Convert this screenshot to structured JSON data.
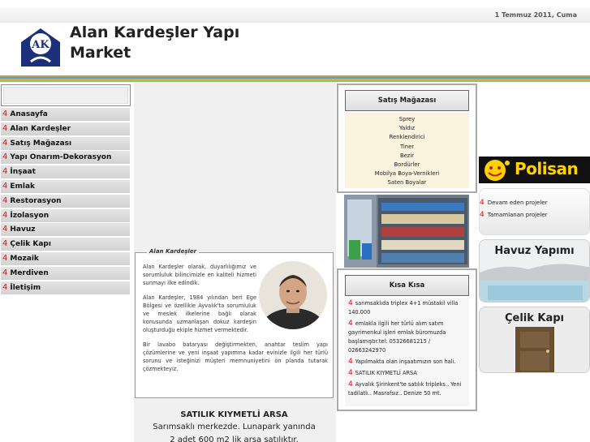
{
  "header": {
    "date": "1 Temmuz 2011, Cuma",
    "site_title": "Alan Kardeşler Yapı Market",
    "logo_text": "AK"
  },
  "colors": {
    "accent_red": "#dd1111",
    "stripe_colors": [
      "#b8a15a",
      "#5aa0c8",
      "#e0b030",
      "#8fbf8f"
    ],
    "store_panel_bg": "#fbf3dd",
    "polisan_yellow": "#ffd200"
  },
  "sidebar": {
    "search_placeholder": "",
    "items": [
      {
        "num": "4",
        "label": "Anasayfa"
      },
      {
        "num": "4",
        "label": "Alan Kardeşler"
      },
      {
        "num": "4",
        "label": "Satış Mağazası"
      },
      {
        "num": "4",
        "label": "Yapı Onarım-Dekorasyon"
      },
      {
        "num": "4",
        "label": "İnşaat"
      },
      {
        "num": "4",
        "label": "Emlak"
      },
      {
        "num": "4",
        "label": "Restorasyon"
      },
      {
        "num": "4",
        "label": "İzolasyon"
      },
      {
        "num": "4",
        "label": "Havuz"
      },
      {
        "num": "4",
        "label": "Çelik Kapı"
      },
      {
        "num": "4",
        "label": "Mozaik"
      },
      {
        "num": "4",
        "label": "Merdiven"
      },
      {
        "num": "4",
        "label": "İletişim"
      }
    ]
  },
  "about": {
    "legend": "Alan Kardeşler",
    "p1": "Alan Kardeşler olarak, duyarlılığımız ve sorumluluk bilincimizle en kaliteli hizmeti sunmayı ilke edindik.",
    "p2": "Alan Kardeşler, 1984 yılından beri Ege Bölgesi ve özellikle Ayvalık'ta sorumluluk ve meslek ilkelerine bağlı olarak konusunda uzmanlaşan dokuz kardeşin oluşturduğu ekiple hizmet vermektedir.",
    "p3": "Bir lavabo bataryası değiştirmekten, anahtar teslim yapı çözümlerine ve yeni inşaat yapımına kadar evinizle ilgili her türlü sorunu ve isteğinizi müşteri memnuniyetini ön planda tutarak çözmekteyiz."
  },
  "listing": {
    "title": "SATILIK KIYMETLİ ARSA",
    "line1": "Sarımsaklı merkezde. Lunapark yanında",
    "line2": "2 adet 600 m2 lik arsa satılıktır."
  },
  "store": {
    "title": "Satış Mağazası",
    "items": [
      "Sprey",
      "Yaldız",
      "Renklendirici",
      "Tiner",
      "Bezir",
      "Bordürler",
      "Mobilya Boya-Vernikleri",
      "Saten Boyalar"
    ]
  },
  "news": {
    "title": "Kısa Kısa",
    "items": [
      {
        "num": "4",
        "text": "sarımsaklıda triplex 4+1 müstakil villa 140.000"
      },
      {
        "num": "4",
        "text": "emlakla ilgili her türlü alım satım gayrimenkul işleri emlak büromuzda başlamıştır.tel: 05326681215 / 02663242970"
      },
      {
        "num": "4",
        "text": "Yapılmakta olan inşaatımızın son hali."
      },
      {
        "num": "4",
        "text": "SATILIK KIYMETLİ ARSA"
      },
      {
        "num": "4",
        "text": "Ayvalık Şirinkent'te satılık tripleks.. Yeni tadilatlı.. Masrafsız.. Denize 50 mt."
      }
    ]
  },
  "right": {
    "brand": "Polisan",
    "projects": [
      {
        "num": "4",
        "label": "Devam eden projeler"
      },
      {
        "num": "4",
        "label": "Tamamlanan projeler"
      }
    ],
    "promo1": "Havuz Yapımı",
    "promo2": "Çelik Kapı"
  }
}
